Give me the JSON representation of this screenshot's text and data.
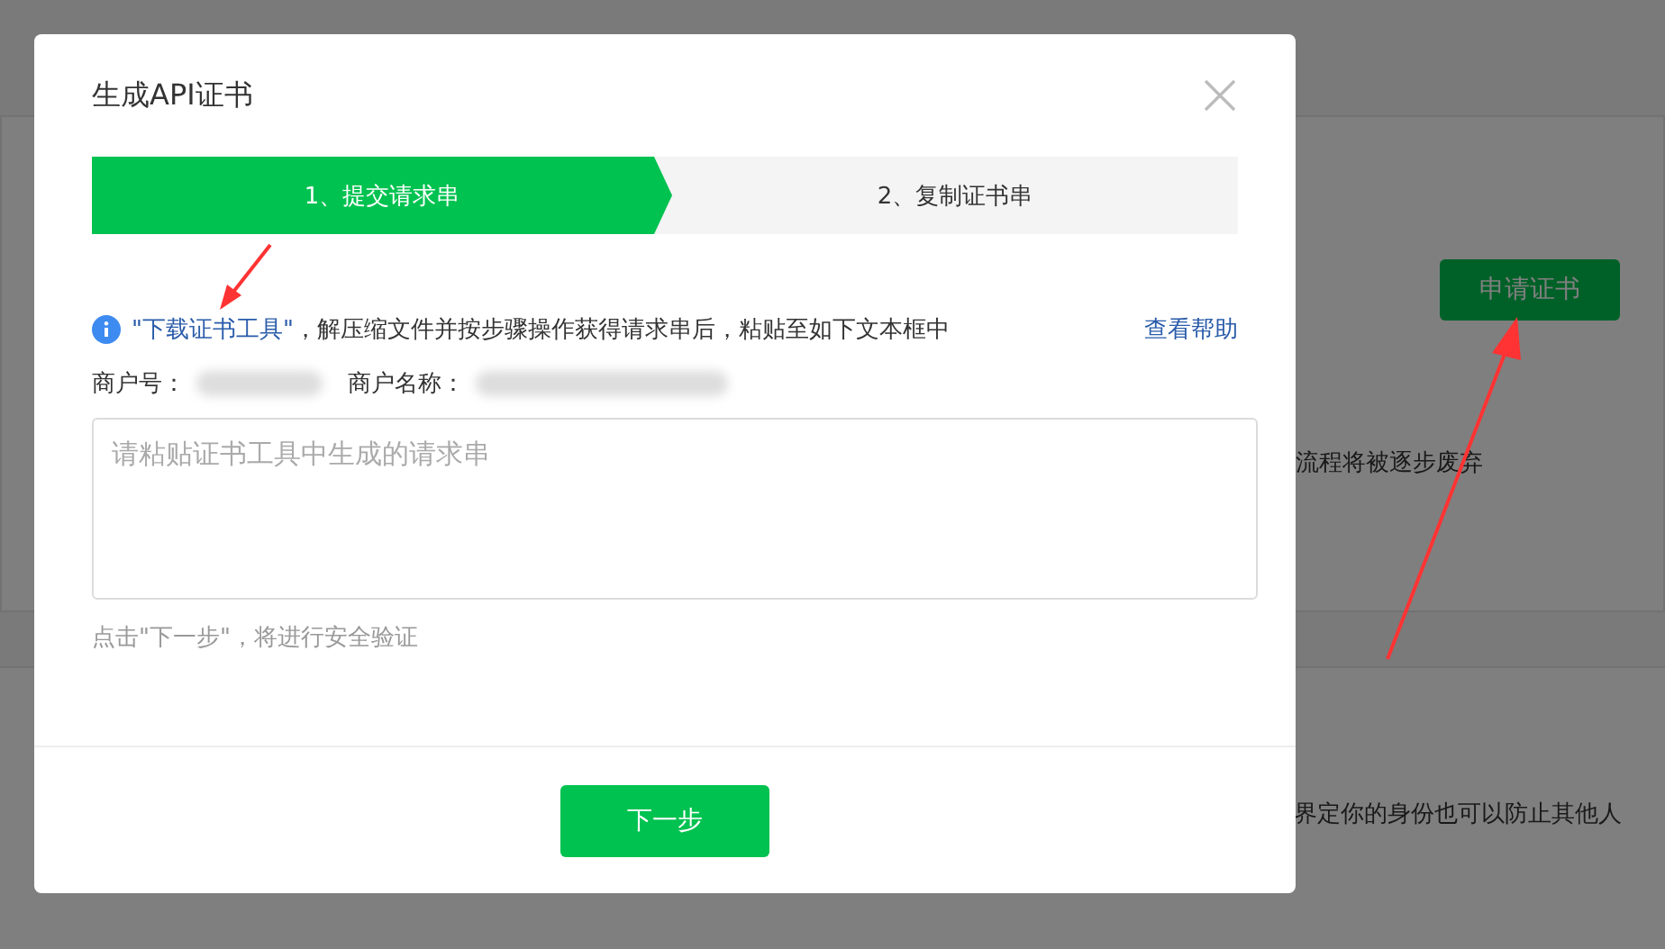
{
  "background_page": {
    "apply_button": "申请证书",
    "notice": "流程将被逐步废弃",
    "description": "界定你的身份也可以防止其他人"
  },
  "dialog": {
    "title": "生成API证书",
    "steps": [
      {
        "label": "1、提交请求串",
        "selected": true
      },
      {
        "label": "2、复制证书串",
        "selected": false
      }
    ],
    "info": {
      "link": "\"下载证书工具\"",
      "text": "，解压缩文件并按步骤操作获得请求串后，粘贴至如下文本框中",
      "help_link": "查看帮助"
    },
    "merchant_id_label": "商户号：",
    "merchant_name_label": "商户名称：",
    "request_field": {
      "placeholder": "请粘贴证书工具中生成的请求串"
    },
    "hint": "点击\"下一步\"，将进行安全验证",
    "next_button": "下一步"
  }
}
